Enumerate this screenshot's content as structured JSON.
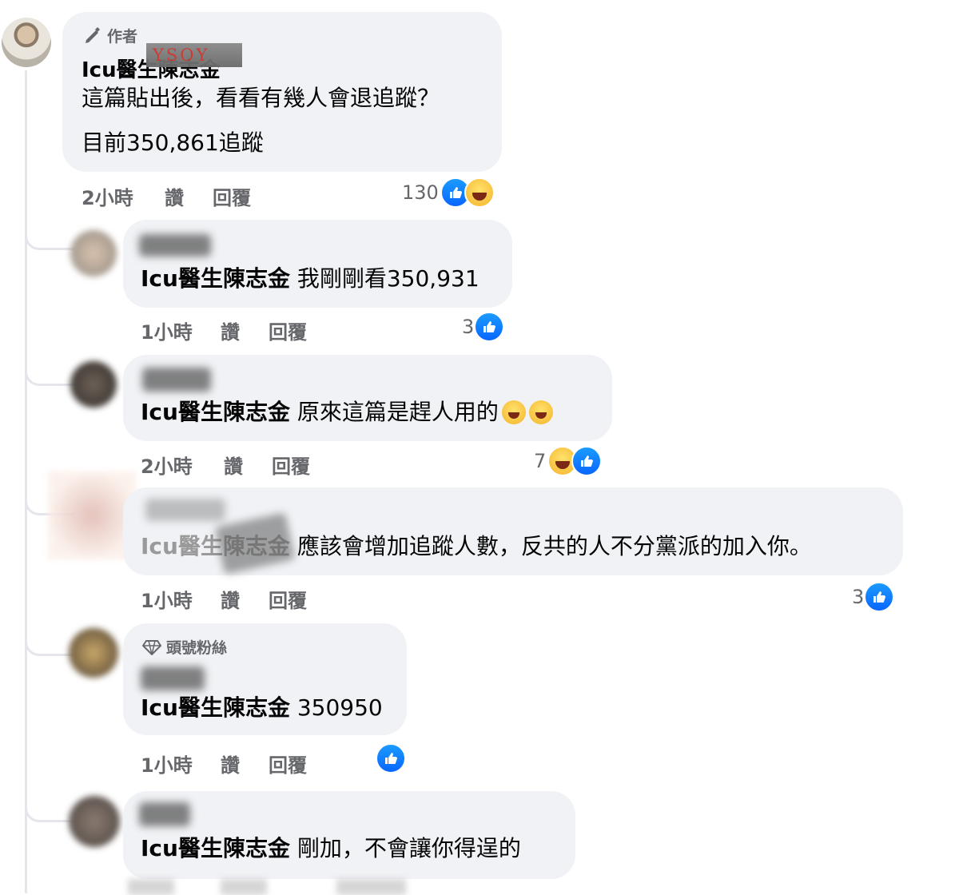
{
  "main_comment": {
    "badge": "作者",
    "author": "Icu醫生陳志金",
    "watermark": "YSOY",
    "line1": "這篇貼出後，看看有幾人會退追蹤？",
    "line2": "目前350,861追蹤",
    "time": "2小時",
    "like_label": "讚",
    "reply_label": "回覆",
    "reaction_count": "130",
    "reactions": [
      "like-icon",
      "haha-icon"
    ]
  },
  "replies": [
    {
      "mention": "Icu醫生陳志金",
      "text": "我剛剛看350,931",
      "time": "1小時",
      "like_label": "讚",
      "reply_label": "回覆",
      "reaction_count": "3"
    },
    {
      "mention": "Icu醫生陳志金",
      "text": "原來這篇是趕人用的",
      "time": "2小時",
      "like_label": "讚",
      "reply_label": "回覆",
      "reaction_count": "7"
    },
    {
      "mention": "Icu醫生陳志金",
      "text": "應該會增加追蹤人數，反共的人不分黨派的加入你。",
      "time": "1小時",
      "like_label": "讚",
      "reply_label": "回覆",
      "reaction_count": "3"
    },
    {
      "badge": "頭號粉絲",
      "mention": "Icu醫生陳志金",
      "text": "350950",
      "time": "1小時",
      "like_label": "讚",
      "reply_label": "回覆",
      "reaction_count": ""
    },
    {
      "mention": "Icu醫生陳志金",
      "text": "剛加，不會讓你得逞的"
    }
  ],
  "colors": {
    "bubble": "#f0f2f5",
    "meta": "#65676b",
    "like": "#0866ff"
  }
}
